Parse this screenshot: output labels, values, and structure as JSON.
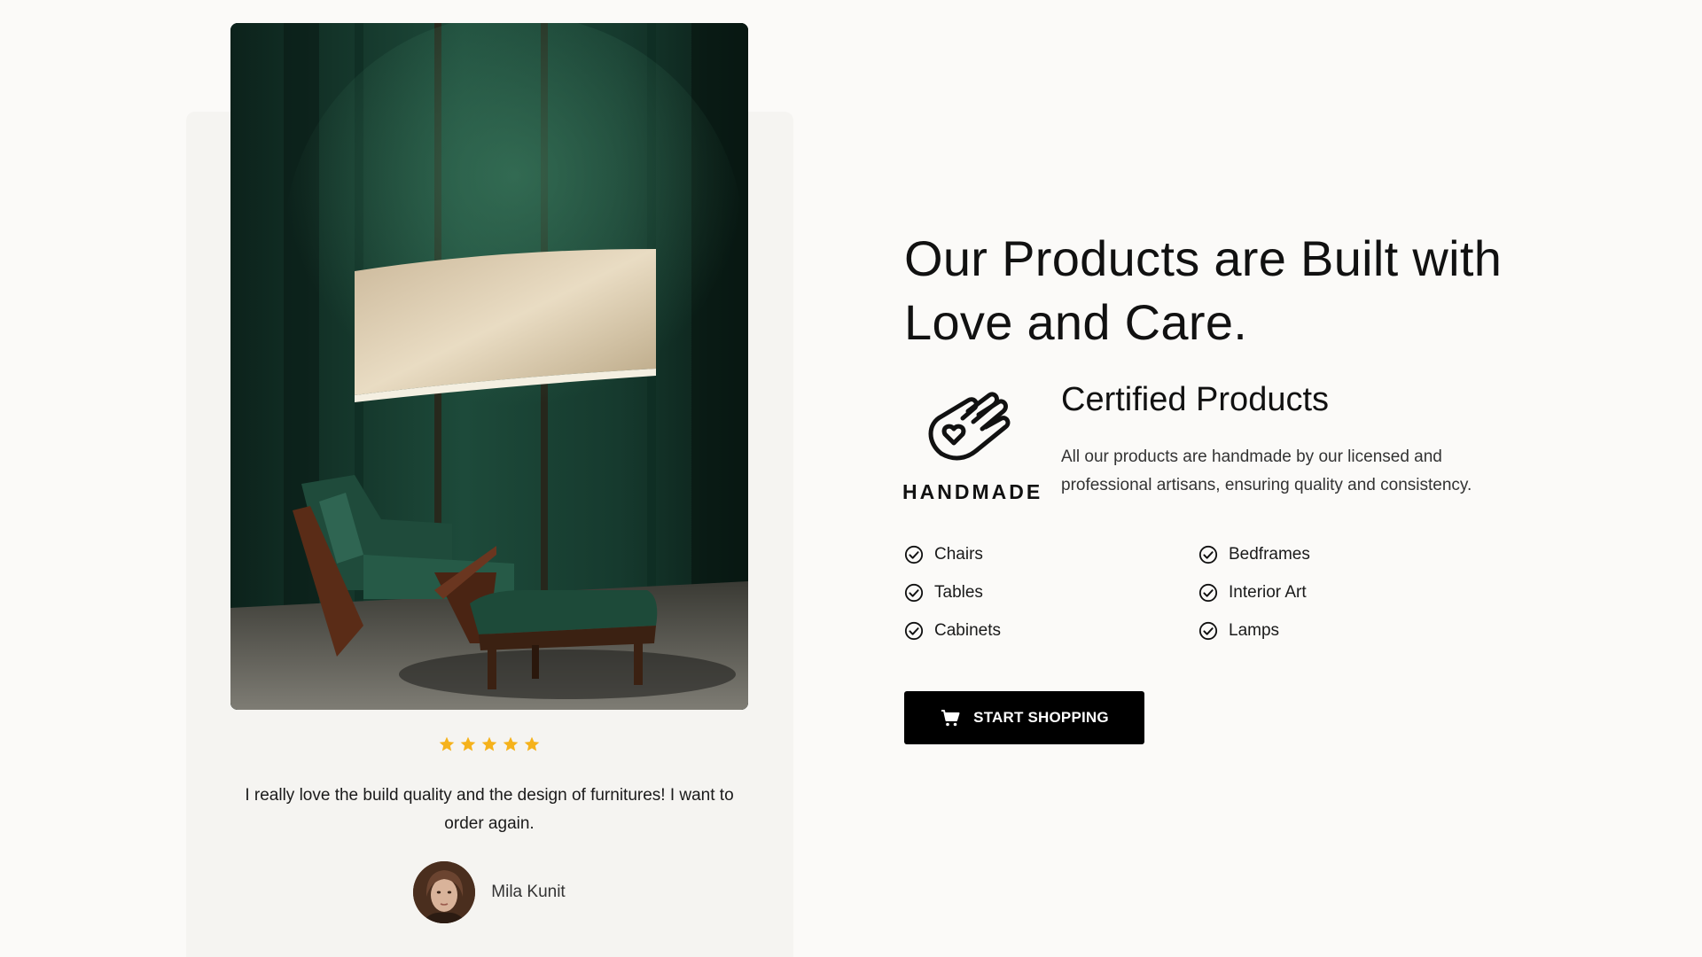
{
  "testimonial": {
    "rating": 5,
    "star_color": "#f5b21b",
    "quote": "I really love the build quality and the design of furnitures! I want to order again.",
    "reviewer_name": "Mila Kunit"
  },
  "main": {
    "headline": "Our Products are Built with Love and Care.",
    "badge_text": "HANDMADE",
    "certified_title": "Certified Products",
    "certified_description": "All our products are handmade by our licensed and professional artisans, ensuring quality and consistency.",
    "features": [
      {
        "label": "Chairs",
        "icon": "check-circle-icon"
      },
      {
        "label": "Bedframes",
        "icon": "check-circle-icon"
      },
      {
        "label": "Tables",
        "icon": "check-circle-icon"
      },
      {
        "label": "Interior Art",
        "icon": "check-circle-icon"
      },
      {
        "label": "Cabinets",
        "icon": "check-circle-icon"
      },
      {
        "label": "Lamps",
        "icon": "check-circle-icon"
      }
    ],
    "cta": {
      "label": "START SHOPPING",
      "icon": "cart-icon"
    }
  },
  "colors": {
    "background": "#fbfaf8",
    "card": "#f5f4f1",
    "button": "#000000",
    "accent_star": "#f5b21b"
  }
}
